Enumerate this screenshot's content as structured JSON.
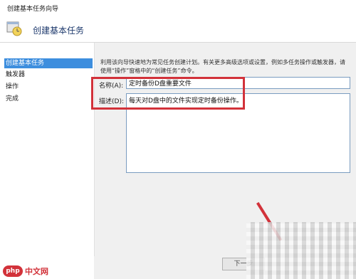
{
  "window": {
    "title": "创建基本任务向导"
  },
  "header": {
    "title": "创建基本任务",
    "icon": "task-wizard-icon"
  },
  "sidebar": {
    "items": [
      {
        "label": "创建基本任务",
        "active": true
      },
      {
        "label": "触发器",
        "active": false
      },
      {
        "label": "操作",
        "active": false
      },
      {
        "label": "完成",
        "active": false
      }
    ]
  },
  "main": {
    "description": "利用该向导快速地为常见任务创建计划。有关更多高级选项或设置，例如多任务操作或触发器，请使用“操作”窗格中的“创建任务”命令。",
    "name_label": "名称(A):",
    "name_value": "定时备份D盘重要文件",
    "desc_label": "描述(D):",
    "desc_value": "每天对D盘中的文件实现定时备份操作。"
  },
  "footer": {
    "next_label": "下一步"
  },
  "watermark": {
    "logo": "php",
    "text": "中文网"
  },
  "colors": {
    "highlight": "#d2323a",
    "selection": "#3d8ede"
  }
}
